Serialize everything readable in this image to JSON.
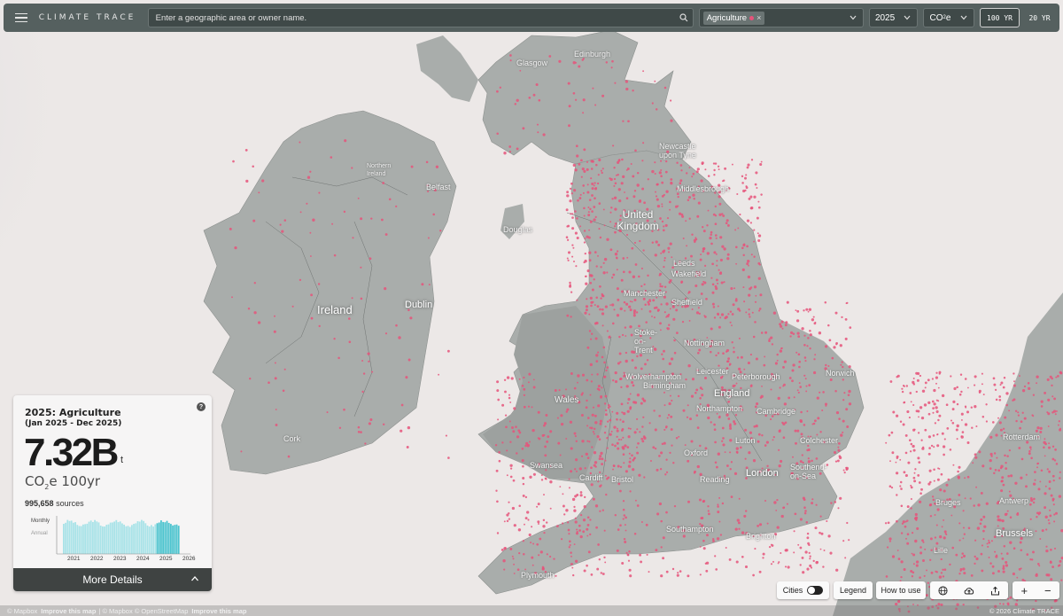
{
  "header": {
    "brand": "CLIMATE TRACE",
    "search_placeholder": "Enter a geographic area or owner name.",
    "sector_chip": "Agriculture",
    "year": "2025",
    "gas_main": "CO",
    "gas_sub": "2",
    "gas_suffix": "e",
    "gwp_options": [
      "100 YR",
      "20 YR"
    ],
    "gwp_selected": "100 YR"
  },
  "map": {
    "places": [
      {
        "name": "Glasgow",
        "kind": "city"
      },
      {
        "name": "Edinburgh",
        "kind": "city"
      },
      {
        "name": "Newcastle upon Tyne",
        "kind": "city"
      },
      {
        "name": "Middlesbrough",
        "kind": "city"
      },
      {
        "name": "United Kingdom",
        "kind": "country"
      },
      {
        "name": "Northern Ireland",
        "kind": "city"
      },
      {
        "name": "Belfast",
        "kind": "city"
      },
      {
        "name": "Douglas",
        "kind": "city"
      },
      {
        "name": "Leeds",
        "kind": "city"
      },
      {
        "name": "Wakefield",
        "kind": "city"
      },
      {
        "name": "Manchester",
        "kind": "city"
      },
      {
        "name": "Sheffield",
        "kind": "city"
      },
      {
        "name": "Ireland",
        "kind": "country"
      },
      {
        "name": "Dublin",
        "kind": "country"
      },
      {
        "name": "Stoke-on-Trent",
        "kind": "city"
      },
      {
        "name": "Nottingham",
        "kind": "city"
      },
      {
        "name": "Norwich",
        "kind": "city"
      },
      {
        "name": "Leicester",
        "kind": "city"
      },
      {
        "name": "Peterborough",
        "kind": "city"
      },
      {
        "name": "Wolverhampton",
        "kind": "city"
      },
      {
        "name": "Birmingham",
        "kind": "city"
      },
      {
        "name": "Wales",
        "kind": "city"
      },
      {
        "name": "England",
        "kind": "country"
      },
      {
        "name": "Northampton",
        "kind": "city"
      },
      {
        "name": "Cambridge",
        "kind": "city"
      },
      {
        "name": "Cork",
        "kind": "city"
      },
      {
        "name": "Luton",
        "kind": "city"
      },
      {
        "name": "Colchester",
        "kind": "city"
      },
      {
        "name": "Oxford",
        "kind": "city"
      },
      {
        "name": "Swansea",
        "kind": "city"
      },
      {
        "name": "Cardiff",
        "kind": "city"
      },
      {
        "name": "Bristol",
        "kind": "city"
      },
      {
        "name": "Reading",
        "kind": "city"
      },
      {
        "name": "London",
        "kind": "country"
      },
      {
        "name": "Southend-on-Sea",
        "kind": "city"
      },
      {
        "name": "Southampton",
        "kind": "city"
      },
      {
        "name": "Brighton",
        "kind": "city"
      },
      {
        "name": "Plymouth",
        "kind": "city"
      },
      {
        "name": "Bruges",
        "kind": "city"
      },
      {
        "name": "Antwerp",
        "kind": "city"
      },
      {
        "name": "Brussels",
        "kind": "country"
      },
      {
        "name": "Lille",
        "kind": "city"
      },
      {
        "name": "Rotterdam",
        "kind": "city"
      }
    ]
  },
  "panel": {
    "title": "2025: Agriculture",
    "subtitle": "(Jan 2025 - Dec 2025)",
    "value": "7.32B",
    "unit": "t",
    "gas_main": "CO",
    "gas_sub": "2",
    "gas_suffix": "e 100yr",
    "sources_count": "995,658",
    "sources_label": "sources",
    "chart_toggle": [
      "Monthly",
      "Annual"
    ],
    "chart_years": [
      "2021",
      "2022",
      "2023",
      "2024",
      "2025",
      "2026"
    ],
    "more_label": "More Details",
    "help": "?"
  },
  "controls": {
    "cities_label": "Cities",
    "legend_label": "Legend",
    "howto_label": "How to use",
    "zoom_in": "+",
    "zoom_out": "−"
  },
  "footer": {
    "mapbox": "© Mapbox",
    "improve1": "Improve this map",
    "credits": "| © Mapbox © OpenStreetMap",
    "improve2": "Improve this map",
    "copyright": "© 2026 Climate TRACE"
  },
  "colors": {
    "land": "#a9adab",
    "sea": "#ece8e7",
    "emission_dots": "#e6537a",
    "topbar": "#55605f"
  }
}
